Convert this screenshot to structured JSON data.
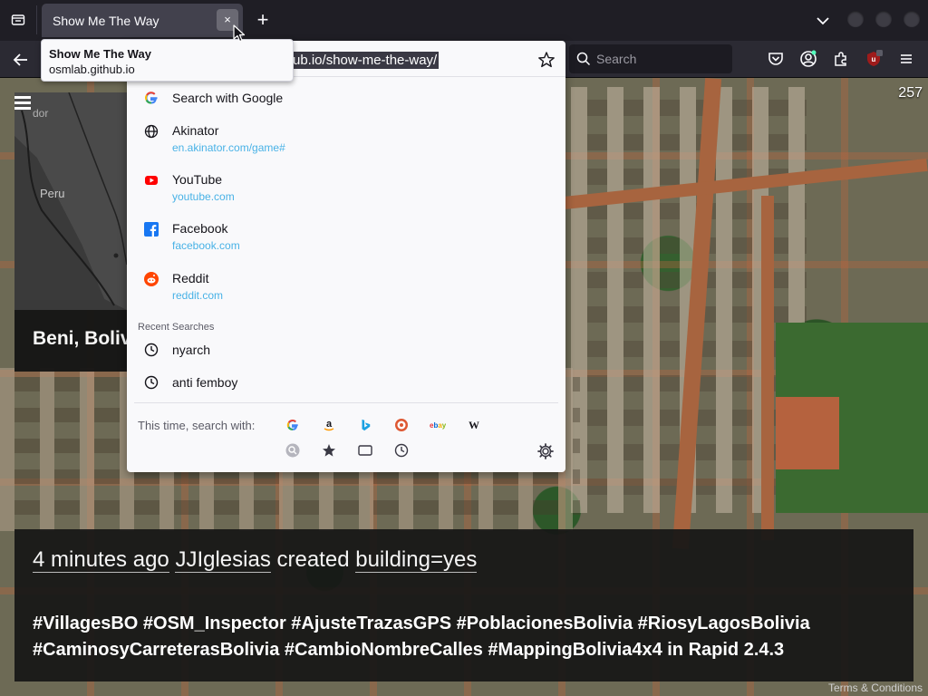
{
  "tab": {
    "title": "Show Me The Way",
    "close_glyph": "×"
  },
  "new_tab_glyph": "+",
  "tooltip": {
    "title": "Show Me The Way",
    "domain": "osmlab.github.io"
  },
  "urlbar": {
    "visible_text": "ub.io/show-me-the-way/"
  },
  "search_bar": {
    "placeholder": "Search"
  },
  "dropdown": {
    "results": [
      {
        "icon": "google-icon",
        "title": "Search with Google",
        "url": ""
      },
      {
        "icon": "globe-icon",
        "title": "Akinator",
        "url": "en.akinator.com/game#"
      },
      {
        "icon": "youtube-icon",
        "title": "YouTube",
        "url": "youtube.com"
      },
      {
        "icon": "facebook-icon",
        "title": "Facebook",
        "url": "facebook.com"
      },
      {
        "icon": "reddit-icon",
        "title": "Reddit",
        "url": "reddit.com"
      }
    ],
    "recent_label": "Recent Searches",
    "recent": [
      {
        "title": "nyarch"
      },
      {
        "title": "anti femboy"
      }
    ],
    "search_with_label": "This time, search with:",
    "engines": [
      "google-icon",
      "amazon-icon",
      "bing-icon",
      "duckduckgo-icon",
      "ebay-icon",
      "wikipedia-icon"
    ],
    "modes": [
      "search-mode-icon",
      "bookmarks-icon",
      "tabs-icon",
      "history-icon"
    ]
  },
  "page": {
    "counter": "257",
    "minimap": {
      "country_label": "Peru",
      "partial_label": "dor"
    },
    "place": "Beni, Bolivia",
    "edit": {
      "time": "4 minutes ago",
      "user": "JJIglesias",
      "action": "created",
      "tag": "building=yes",
      "hashtags": "#VillagesBO #OSM_Inspector #AjusteTrazasGPS #PoblacionesBolivia #RiosyLagosBolivia #CaminosyCarreterasBolivia #CambioNombreCalles #MappingBolivia4x4 in Rapid 2.4.3"
    },
    "terms": "Terms & Conditions"
  },
  "colors": {
    "toolbar_bg": "#2b2a33",
    "tabstrip_bg": "#1f1e25",
    "popup_bg": "#f9f9fb",
    "link_blue": "#0c9adf",
    "ublock_red": "#9e1b1b"
  }
}
